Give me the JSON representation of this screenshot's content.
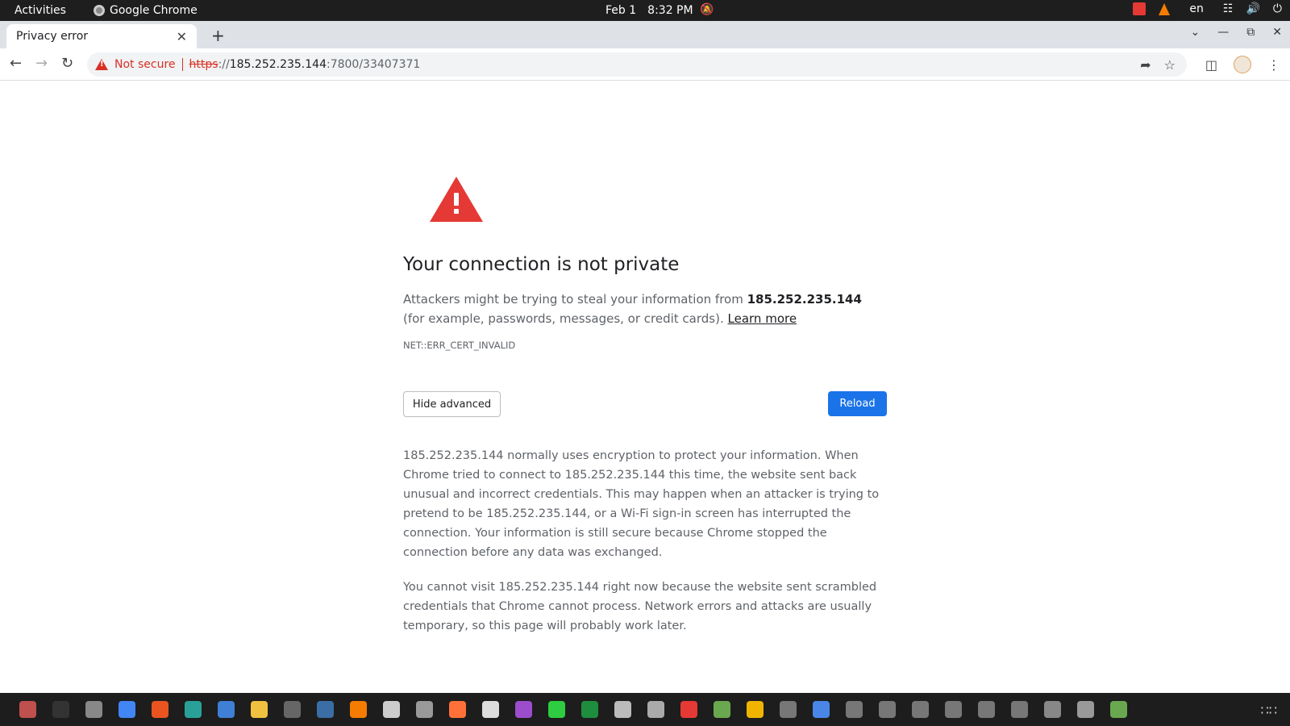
{
  "system_bar": {
    "activities": "Activities",
    "app_name": "Google Chrome",
    "date": "Feb 1",
    "time": "8:32 PM",
    "lang": "en"
  },
  "tabs": [
    {
      "title": "Privacy error"
    }
  ],
  "omnibox": {
    "security_label": "Not secure",
    "url_scheme": "https",
    "url_sep": "://",
    "url_host": "185.252.235.144",
    "url_path": ":7800/33407371"
  },
  "page": {
    "heading": "Your connection is not private",
    "desc_prefix": "Attackers might be trying to steal your information from ",
    "desc_host": "185.252.235.144",
    "desc_suffix": " (for example, passwords, messages, or credit cards). ",
    "learn_more": "Learn more",
    "error_code": "NET::ERR_CERT_INVALID",
    "hide_advanced": "Hide advanced",
    "reload": "Reload",
    "details_1": "185.252.235.144 normally uses encryption to protect your information. When Chrome tried to connect to 185.252.235.144 this time, the website sent back unusual and incorrect credentials. This may happen when an attacker is trying to pretend to be 185.252.235.144, or a Wi-Fi sign-in screen has interrupted the connection. Your information is still secure because Chrome stopped the connection before any data was exchanged.",
    "details_2": "You cannot visit 185.252.235.144 right now because the website sent scrambled credentials that Chrome cannot process. Network errors and attacks are usually temporary, so this page will probably work later."
  },
  "dock": {
    "items": [
      {
        "name": "files",
        "color": "#c0504d"
      },
      {
        "name": "terminal",
        "color": "#333333"
      },
      {
        "name": "image-viewer",
        "color": "#888888"
      },
      {
        "name": "chrome",
        "color": "#4285f4"
      },
      {
        "name": "software-center",
        "color": "#e95420"
      },
      {
        "name": "app-5",
        "color": "#2aa198"
      },
      {
        "name": "text-editor",
        "color": "#3f7fd6"
      },
      {
        "name": "calculator",
        "color": "#f0c040"
      },
      {
        "name": "app-8",
        "color": "#666666"
      },
      {
        "name": "app-9",
        "color": "#3a6ea5"
      },
      {
        "name": "vlc",
        "color": "#f57c00"
      },
      {
        "name": "app-11",
        "color": "#cccccc"
      },
      {
        "name": "app-12",
        "color": "#999999"
      },
      {
        "name": "firefox",
        "color": "#ff7139"
      },
      {
        "name": "app-14",
        "color": "#dddddd"
      },
      {
        "name": "app-15",
        "color": "#9c4dcc"
      },
      {
        "name": "app-16",
        "color": "#2ecc40"
      },
      {
        "name": "spreadsheet",
        "color": "#1e8e3e"
      },
      {
        "name": "app-18",
        "color": "#bbbbbb"
      },
      {
        "name": "app-19",
        "color": "#aaaaaa"
      },
      {
        "name": "anydesk",
        "color": "#e53935"
      },
      {
        "name": "app-21",
        "color": "#6aa84f"
      },
      {
        "name": "app-22",
        "color": "#f0b400"
      },
      {
        "name": "app-23",
        "color": "#777777"
      },
      {
        "name": "document",
        "color": "#4a86e8"
      },
      {
        "name": "app-25",
        "color": "#777777"
      },
      {
        "name": "app-26",
        "color": "#777777"
      },
      {
        "name": "app-27",
        "color": "#777777"
      },
      {
        "name": "app-28",
        "color": "#777777"
      },
      {
        "name": "app-29",
        "color": "#777777"
      },
      {
        "name": "app-30",
        "color": "#777777"
      },
      {
        "name": "app-31",
        "color": "#888888"
      },
      {
        "name": "app-32",
        "color": "#999999"
      },
      {
        "name": "trash",
        "color": "#6aa84f"
      }
    ]
  }
}
